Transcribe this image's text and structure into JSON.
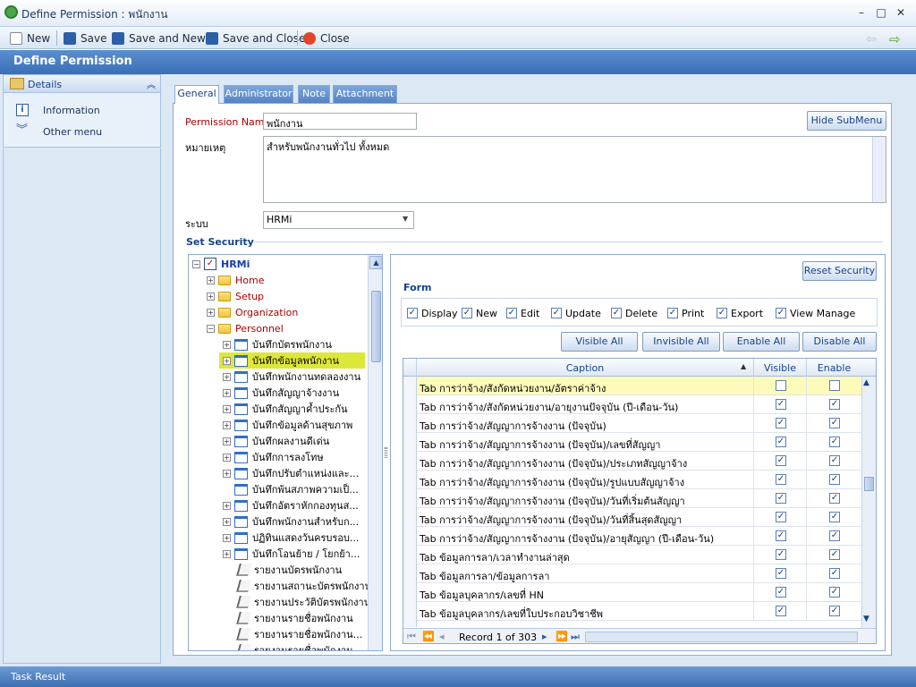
{
  "window": {
    "title": "Define Permission : พนักงาน"
  },
  "toolbar": {
    "new": "New",
    "save": "Save",
    "save_new": "Save and New",
    "save_close": "Save and Close",
    "close": "Close"
  },
  "header": {
    "title": "Define Permission"
  },
  "left": {
    "title": "Details",
    "items": [
      {
        "label": "Information"
      },
      {
        "label": "Other menu"
      }
    ]
  },
  "tabs": [
    {
      "label": "General"
    },
    {
      "label": "Administrator"
    },
    {
      "label": "Note"
    },
    {
      "label": "Attachment"
    }
  ],
  "form": {
    "name_label": "Permission Name",
    "name_value": "พนักงาน",
    "note_label": "หมายเหตุ",
    "note_value": "สำหรับพนักงานทั่วไป ทั้งหมด",
    "system_label": "ระบบ",
    "system_value": "HRMi",
    "hide_submenu": "Hide SubMenu",
    "set_security": "Set Security"
  },
  "tree": {
    "root": "HRMi",
    "folders": [
      "Home",
      "Setup",
      "Organization",
      "Personnel"
    ],
    "items": [
      "บันทึกบัตรพนักงาน",
      "บันทึกข้อมูลพนักงาน",
      "บันทึกพนักงานทดลองงาน",
      "บันทึกสัญญาจ้างงาน",
      "บันทึกสัญญาค้ำประกัน",
      "บันทึกข้อมูลด้านสุขภาพ",
      "บันทึกผลงานดีเด่น",
      "บันทึกการลงโทษ",
      "บันทึกปรับตำแหน่งและ...",
      "บันทึกพ้นสภาพความเป็...",
      "บันทึกอัตราหักกองทุนส...",
      "บันทึกพนักงานสำหรับก...",
      "ปฏิทินแสดงวันครบรอบ...",
      "บันทึกโอนย้าย / โยกย้า..."
    ],
    "reports": [
      "รายงานบัตรพนักงาน",
      "รายงานสถานะบัตรพนักงาน",
      "รายงานประวัติบัตรพนักงาน",
      "รายงานรายชื่อพนักงาน",
      "รายงานรายชื่อพนักงาน...",
      "รายงานรายชื่อพนักงาน..."
    ]
  },
  "security": {
    "reset": "Reset Security",
    "form_label": "Form",
    "perms": [
      "Display",
      "New",
      "Edit",
      "Update",
      "Delete",
      "Print",
      "Export",
      "View Manage"
    ],
    "buttons": [
      "Visible All",
      "Invisible All",
      "Enable All",
      "Disable All"
    ]
  },
  "grid": {
    "headers": {
      "caption": "Caption",
      "visible": "Visible",
      "enable": "Enable"
    },
    "rows": [
      {
        "caption": "Tab การว่าจ้าง/สังกัดหน่วยงาน/อัตราค่าจ้าง",
        "visible": false,
        "enable": false
      },
      {
        "caption": "Tab การว่าจ้าง/สังกัดหน่วยงาน/อายุงานปัจจุบัน (ปี-เดือน-วัน)",
        "visible": true,
        "enable": true
      },
      {
        "caption": "Tab การว่าจ้าง/สัญญาการจ้างงาน (ปัจจุบัน)",
        "visible": true,
        "enable": true
      },
      {
        "caption": "Tab การว่าจ้าง/สัญญาการจ้างงาน (ปัจจุบัน)/เลขที่สัญญา",
        "visible": true,
        "enable": true
      },
      {
        "caption": "Tab การว่าจ้าง/สัญญาการจ้างงาน (ปัจจุบัน)/ประเภทสัญญาจ้าง",
        "visible": true,
        "enable": true
      },
      {
        "caption": "Tab การว่าจ้าง/สัญญาการจ้างงาน (ปัจจุบัน)/รูปแบบสัญญาจ้าง",
        "visible": true,
        "enable": true
      },
      {
        "caption": "Tab การว่าจ้าง/สัญญาการจ้างงาน (ปัจจุบัน)/วันที่เริ่มต้นสัญญา",
        "visible": true,
        "enable": true
      },
      {
        "caption": "Tab การว่าจ้าง/สัญญาการจ้างงาน (ปัจจุบัน)/วันที่สิ้นสุดสัญญา",
        "visible": true,
        "enable": true
      },
      {
        "caption": "Tab การว่าจ้าง/สัญญาการจ้างงาน (ปัจจุบัน)/อายุสัญญา (ปี-เดือน-วัน)",
        "visible": true,
        "enable": true
      },
      {
        "caption": "Tab ข้อมูลการลา/เวลาทำงานล่าสุด",
        "visible": true,
        "enable": true
      },
      {
        "caption": "Tab ข้อมูลการลา/ข้อมูลการลา",
        "visible": true,
        "enable": true
      },
      {
        "caption": "Tab ข้อมูลบุคลากร/เลขที่ HN",
        "visible": true,
        "enable": true
      },
      {
        "caption": "Tab ข้อมูลบุคลากร/เลขที่ใบประกอบวิชาชีพ",
        "visible": true,
        "enable": true
      }
    ],
    "record_label": "Record 1 of 303"
  },
  "status": {
    "label": "Task Result"
  }
}
